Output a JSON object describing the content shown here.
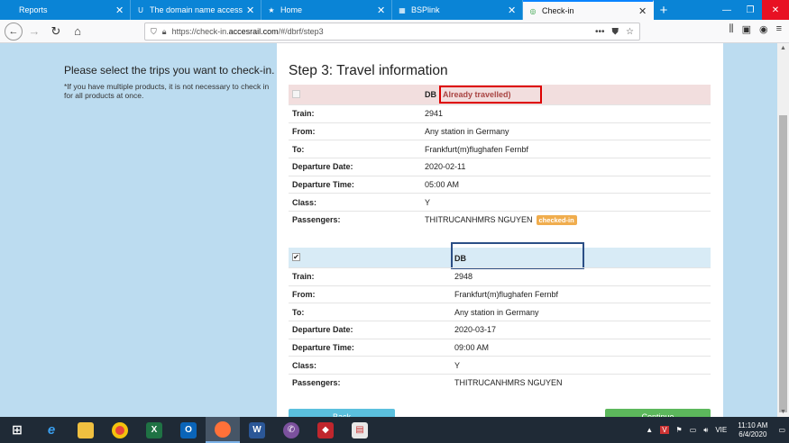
{
  "tabs": [
    {
      "title": "Reports",
      "icon": "",
      "active": false
    },
    {
      "title": "The domain name accessrail.c",
      "icon": "U",
      "active": false
    },
    {
      "title": "Home",
      "icon": "★",
      "active": false
    },
    {
      "title": "BSPlink",
      "icon": "▦",
      "active": false
    },
    {
      "title": "Check-in",
      "icon": "◎",
      "active": true
    }
  ],
  "address": {
    "prefix": "https://check-in.",
    "domain": "accesrail.com",
    "path": "/#/dbrf/step3"
  },
  "sidebar": {
    "heading": "Please select the trips you want to check-in.",
    "note": "*If you have multiple products, it is not necessary to check in for all products at once."
  },
  "main": {
    "title": "Step 3: Travel information",
    "labels": {
      "train": "Train:",
      "from": "From:",
      "to": "To:",
      "departure_date": "Departure Date:",
      "departure_time": "Departure Time:",
      "class": "Class:",
      "passengers": "Passengers:"
    },
    "trip1": {
      "operator": "DB",
      "status": "Already travelled)",
      "train": "2941",
      "from": "Any station in Germany",
      "to": "Frankfurt(m)flughafen Fernbf",
      "departure_date": "2020-02-11",
      "departure_time": "05:00 AM",
      "class": "Y",
      "passengers": "THITRUCANHMRS NGUYEN",
      "badge": "checked-in"
    },
    "trip2": {
      "operator": "DB",
      "checkbox": "✔",
      "train": "2948",
      "from": "Frankfurt(m)flughafen Fernbf",
      "to": "Any station in Germany",
      "departure_date": "2020-03-17",
      "departure_time": "09:00 AM",
      "class": "Y",
      "passengers": "THITRUCANHMRS NGUYEN"
    },
    "back_label": "Back",
    "continue_label": "Continue"
  },
  "taskbar": {
    "lang": "VIE",
    "time": "11:10 AM",
    "date": "6/4/2020"
  },
  "colors": {
    "tabbar": "#0a84d6",
    "page_bg": "#bcdcf0",
    "travelled_border": "#dd0000",
    "badge": "#f0ad4e"
  }
}
